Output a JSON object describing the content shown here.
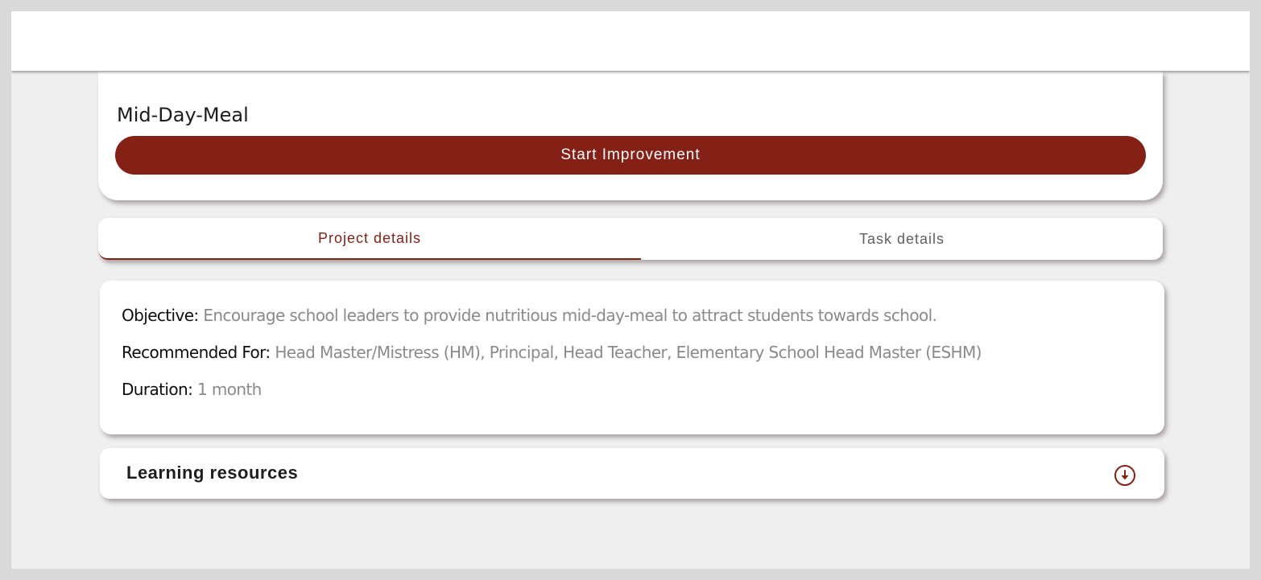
{
  "project": {
    "title": "Mid-Day-Meal",
    "start_button_label": "Start Improvement"
  },
  "tabs": [
    {
      "label": "Project details",
      "active": true
    },
    {
      "label": "Task details",
      "active": false
    }
  ],
  "details": {
    "objective": {
      "label": "Objective:",
      "value": "Encourage school leaders to provide nutritious mid-day-meal to attract students towards school."
    },
    "recommended_for": {
      "label": "Recommended For:",
      "value": "Head Master/Mistress (HM), Principal, Head Teacher, Elementary School Head Master (ESHM)"
    },
    "duration": {
      "label": "Duration:",
      "value": "1 month"
    }
  },
  "learning_resources": {
    "title": "Learning resources",
    "icon": "download-circle-icon"
  },
  "colors": {
    "accent": "#852017",
    "muted_text": "#8a8a8a",
    "page_background": "#efefef",
    "outer_background": "#d9d9d9"
  }
}
